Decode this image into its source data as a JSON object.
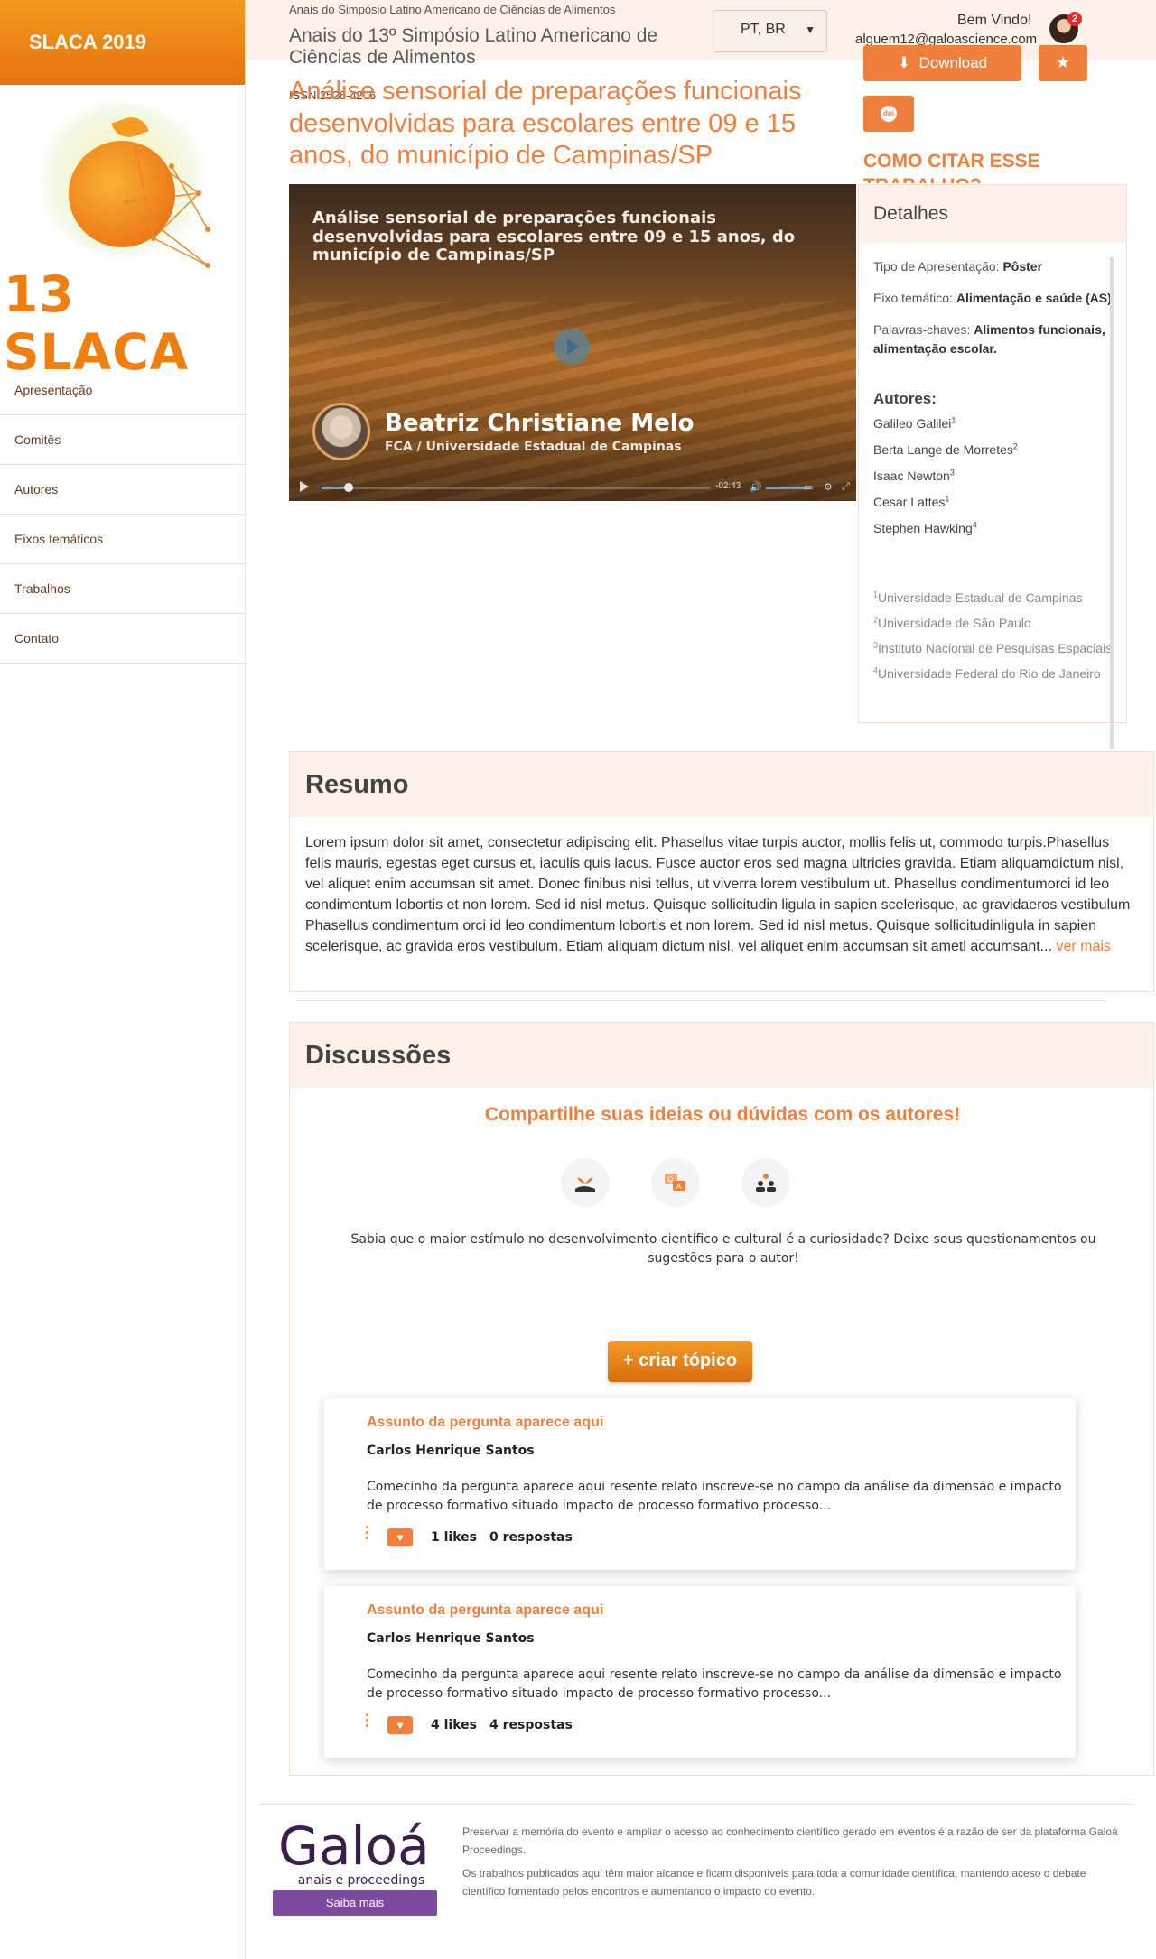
{
  "sidebar": {
    "brand": "SLACA 2019",
    "logo_text": "13 SLACA",
    "nav": [
      "Apresentação",
      "Comitês",
      "Autores",
      "Eixos temáticos",
      "Trabalhos",
      "Contato"
    ]
  },
  "header": {
    "event_small": "Anais do Simpósio Latino Americano de Ciências de Alimentos",
    "event_title": "Anais do 13º Simpósio Latino Americano de Ciências de Alimentos",
    "issn": "ISSN 2526-4206",
    "language": "PT, BR",
    "welcome": "Bem Vindo!",
    "email": "alguem12@galoascience.com",
    "notifications": "2",
    "download_label": "Download",
    "doi_label": "doi",
    "cite_label": "COMO CITAR ESSE TRABALHO?"
  },
  "paper": {
    "title": "Análise sensorial de preparações funcionais desenvolvidas para escolares entre 09 e 15 anos, do município de Campinas/SP"
  },
  "video": {
    "title": "Análise sensorial de preparações funcionais desenvolvidas para escolares entre 09 e 15 anos, do município de Campinas/SP",
    "speaker": "Beatriz Christiane Melo",
    "affiliation": "FCA / Universidade Estadual de Campinas",
    "time": "-02:43",
    "progress": 0.07
  },
  "details": {
    "heading": "Detalhes",
    "tipo_label": "Tipo de Apresentação:",
    "tipo_value": "Pôster",
    "eixo_label": "Eixo temático:",
    "eixo_value": "Alimentação e saúde (AS)",
    "palavras_label": "Palavras-chaves:",
    "palavras_value": "Alimentos funcionais, alimentação escolar.",
    "authors_heading": "Autores:",
    "authors": [
      {
        "name": "Galileo Galilei",
        "sup": "1"
      },
      {
        "name": "Berta Lange de Morretes",
        "sup": "2"
      },
      {
        "name": "Isaac Newton",
        "sup": "3"
      },
      {
        "name": "Cesar Lattes",
        "sup": "1"
      },
      {
        "name": "Stephen Hawking",
        "sup": "4"
      }
    ],
    "institutions": [
      {
        "sup": "1",
        "name": "Universidade Estadual de Campinas"
      },
      {
        "sup": "2",
        "name": "Universidade de São Paulo"
      },
      {
        "sup": "3",
        "name": "Instituto Nacional de Pesquisas Espaciais"
      },
      {
        "sup": "4",
        "name": "Universidade Federal do Rio de Janeiro"
      }
    ]
  },
  "resumo": {
    "heading": "Resumo",
    "text": "Lorem ipsum dolor sit amet, consectetur adipiscing elit. Phasellus vitae turpis auctor, mollis felis ut, commodo turpis.Phasellus felis mauris, egestas eget cursus et, iaculis quis lacus. Fusce auctor eros sed magna ultricies gravida. Etiam aliquamdictum nisl, vel aliquet enim accumsan sit amet. Donec finibus nisi tellus, ut viverra lorem vestibulum ut. Phasellus condimentumorci id leo condimentum lobortis et non lorem. Sed id nisl metus. Quisque sollicitudin ligula in sapien scelerisque, ac gravidaeros vestibulum Phasellus condimentum orci id leo condimentum lobortis et non lorem. Sed id nisl metus. Quisque sollicitudinligula in sapien scelerisque, ac gravida eros vestibulum. Etiam aliquam dictum nisl, vel aliquet enim accumsan sit ametl accumsant...",
    "more": "ver mais"
  },
  "discussoes": {
    "heading": "Discussões",
    "share": "Compartilhe suas ideias ou dúvidas com os autores!",
    "lead": "Sabia que o maior estímulo no desenvolvimento científico e cultural é a curiosidade? Deixe seus questionamentos ou sugestões para o autor!",
    "create_label": "+ criar tópico",
    "topics": [
      {
        "question": "Assunto da pergunta aparece aqui",
        "author": "Carlos Henrique Santos",
        "excerpt": "Comecinho da pergunta aparece aqui resente relato inscreve-se no campo da análise da dimensão e impacto de processo formativo situado impacto de processo formativo processo...",
        "likes": "1 likes",
        "responses": "0 respostas"
      },
      {
        "question": "Assunto da pergunta aparece aqui",
        "author": "Carlos Henrique Santos",
        "excerpt": "Comecinho da pergunta aparece aqui resente relato inscreve-se no campo da análise da dimensão e impacto de processo formativo situado impacto de processo formativo processo...",
        "likes": "4 likes",
        "responses": "4 respostas"
      }
    ]
  },
  "footer": {
    "logo": "Galoá",
    "logo_sub": "anais e proceedings",
    "saiba": "Saiba mais",
    "p1": "Preservar a memória do evento e ampliar o acesso ao conhecimento científico gerado em eventos é a razão de ser da plataforma Galoá Proceedings.",
    "p2": "Os trabalhos publicados aqui têm maior alcance e ficam disponíveis para toda a comunidade científica, mantendo aceso o debate científico fomentado pelos encontros e aumentando o impacto do evento."
  },
  "colors": {
    "accent": "#f07f3c",
    "panel": "#fdf1ea",
    "brand_purple": "#7e4aa0"
  }
}
